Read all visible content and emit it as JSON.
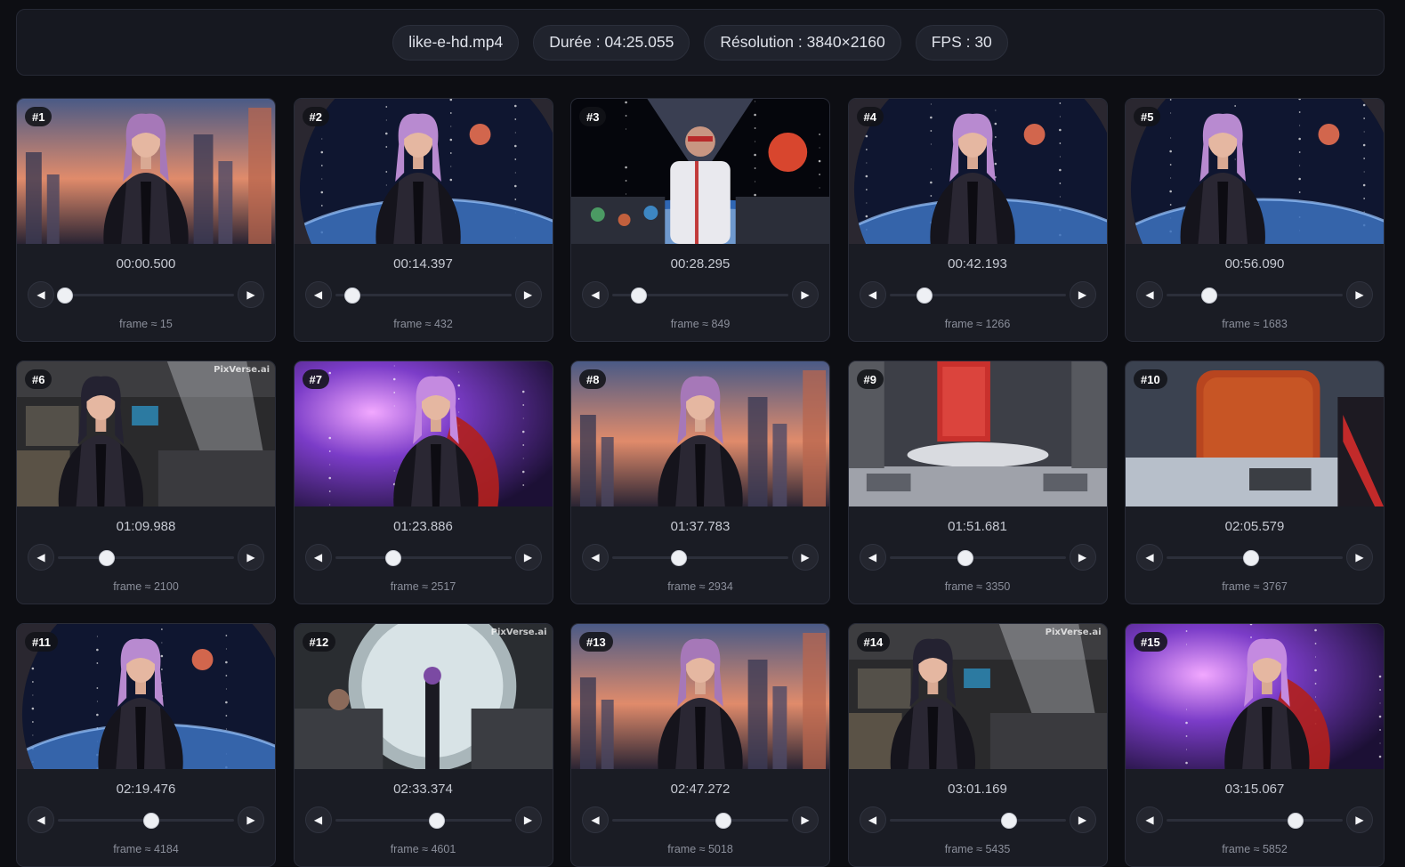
{
  "header": {
    "filename": "like-e-hd.mp4",
    "duration": "Durée : 04:25.055",
    "resolution": "Résolution : 3840×2160",
    "fps": "FPS : 30"
  },
  "colors": {
    "background": "#0d0e13",
    "card": "#1a1c24",
    "pill": "#20232d",
    "knob": "#eef0f4"
  },
  "icons": {
    "prev": "◀",
    "next": "▶"
  },
  "cards": [
    {
      "badge": "#1",
      "time": "00:00.500",
      "frame": "frame ≈ 15",
      "position": 0.04,
      "scene": "city"
    },
    {
      "badge": "#2",
      "time": "00:14.397",
      "frame": "frame ≈ 432",
      "position": 0.1,
      "scene": "space"
    },
    {
      "badge": "#3",
      "time": "00:28.295",
      "frame": "frame ≈ 849",
      "position": 0.15,
      "scene": "cockpit"
    },
    {
      "badge": "#4",
      "time": "00:42.193",
      "frame": "frame ≈ 1266",
      "position": 0.2,
      "scene": "space"
    },
    {
      "badge": "#5",
      "time": "00:56.090",
      "frame": "frame ≈ 1683",
      "position": 0.24,
      "scene": "space2"
    },
    {
      "badge": "#6",
      "time": "01:09.988",
      "frame": "frame ≈ 2100",
      "position": 0.28,
      "scene": "room",
      "watermark": "PixVerse.ai"
    },
    {
      "badge": "#7",
      "time": "01:23.886",
      "frame": "frame ≈ 2517",
      "position": 0.33,
      "scene": "purple"
    },
    {
      "badge": "#8",
      "time": "01:37.783",
      "frame": "frame ≈ 2934",
      "position": 0.38,
      "scene": "city"
    },
    {
      "badge": "#9",
      "time": "01:51.681",
      "frame": "frame ≈ 3350",
      "position": 0.43,
      "scene": "tech"
    },
    {
      "badge": "#10",
      "time": "02:05.579",
      "frame": "frame ≈ 3767",
      "position": 0.48,
      "scene": "reactor"
    },
    {
      "badge": "#11",
      "time": "02:19.476",
      "frame": "frame ≈ 4184",
      "position": 0.53,
      "scene": "space"
    },
    {
      "badge": "#12",
      "time": "02:33.374",
      "frame": "frame ≈ 4601",
      "position": 0.58,
      "scene": "vault",
      "watermark": "PixVerse.ai"
    },
    {
      "badge": "#13",
      "time": "02:47.272",
      "frame": "frame ≈ 5018",
      "position": 0.63,
      "scene": "city"
    },
    {
      "badge": "#14",
      "time": "03:01.169",
      "frame": "frame ≈ 5435",
      "position": 0.68,
      "scene": "room",
      "watermark": "PixVerse.ai"
    },
    {
      "badge": "#15",
      "time": "03:15.067",
      "frame": "frame ≈ 5852",
      "position": 0.73,
      "scene": "purple"
    }
  ]
}
